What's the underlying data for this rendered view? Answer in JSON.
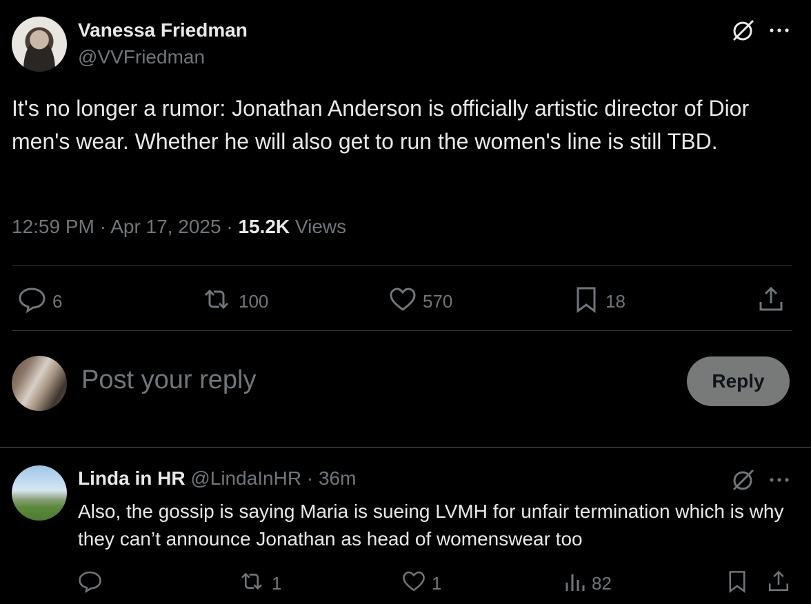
{
  "post": {
    "author_name": "Vanessa Friedman",
    "author_handle": "@VVFriedman",
    "text": "It's no longer a rumor: Jonathan Anderson is officially artistic director of Dior men's wear. Whether he will also get to run the women's line is still TBD.",
    "time": "12:59 PM",
    "separator": "·",
    "date": "Apr 17, 2025",
    "views_count": "15.2K",
    "views_label": "Views",
    "replies": "6",
    "reposts": "100",
    "likes": "570",
    "bookmarks": "18"
  },
  "composer": {
    "placeholder": "Post your reply",
    "button_label": "Reply"
  },
  "reply": {
    "author_name": "Linda in HR",
    "author_handle": "@LindaInHR",
    "separator": "·",
    "time_ago": "36m",
    "text": "Also, the gossip is saying Maria is sueing LVMH for unfair termination which is why they can’t announce Jonathan as head of womenswear too",
    "replies": "",
    "reposts": "1",
    "likes": "1",
    "views": "82"
  },
  "icons": {
    "grok": "grok-icon",
    "more": "more-icon",
    "reply": "reply-icon",
    "repost": "repost-icon",
    "like": "heart-icon",
    "bookmark": "bookmark-icon",
    "share": "share-icon",
    "views": "views-icon"
  },
  "colors": {
    "background": "#000000",
    "text_primary": "#e7e9ea",
    "text_secondary": "#71767b",
    "divider": "#2f3336",
    "reply_button": "#787a7a"
  }
}
